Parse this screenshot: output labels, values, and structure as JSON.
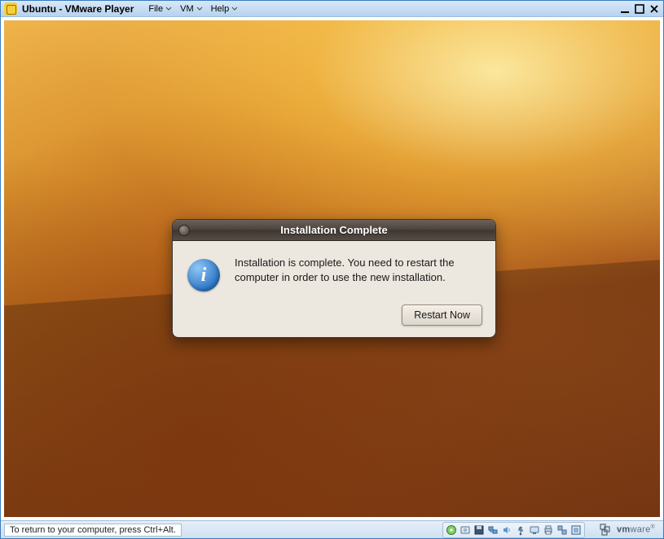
{
  "window": {
    "title": "Ubuntu - VMware Player",
    "menu": [
      "File",
      "VM",
      "Help"
    ]
  },
  "dialog": {
    "title": "Installation Complete",
    "message": "Installation is complete. You need to restart the computer in order to use the new installation.",
    "button": "Restart Now"
  },
  "statusbar": {
    "hint": "To return to your computer, press Ctrl+Alt.",
    "brand_prefix": "vm",
    "brand_suffix": "ware"
  }
}
